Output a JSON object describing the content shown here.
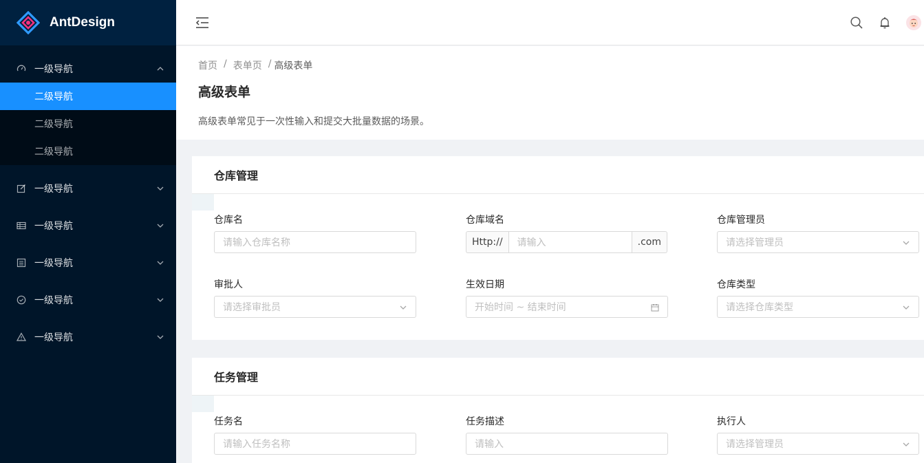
{
  "brand": {
    "name": "AntDesign"
  },
  "sidebar": {
    "items": [
      {
        "label": "一级导航",
        "icon": "dashboard-icon",
        "expanded": true,
        "children": [
          {
            "label": "二级导航",
            "active": true
          },
          {
            "label": "二级导航"
          },
          {
            "label": "二级导航"
          }
        ]
      },
      {
        "label": "一级导航",
        "icon": "form-icon"
      },
      {
        "label": "一级导航",
        "icon": "table-icon"
      },
      {
        "label": "一级导航",
        "icon": "profile-icon"
      },
      {
        "label": "一级导航",
        "icon": "check-circle-icon"
      },
      {
        "label": "一级导航",
        "icon": "warning-icon"
      }
    ]
  },
  "header": {
    "icons": [
      "menu-fold-icon",
      "search-icon",
      "bell-icon",
      "avatar"
    ]
  },
  "page": {
    "breadcrumb": [
      "首页",
      "/",
      "表单页",
      "/",
      "高级表单"
    ],
    "title": "高级表单",
    "description": "高级表单常见于一次性输入和提交大批量数据的场景。"
  },
  "warehouse": {
    "title": "仓库管理",
    "name_label": "仓库名",
    "name_placeholder": "请输入仓库名称",
    "domain_label": "仓库域名",
    "domain_prefix": "Http://",
    "domain_placeholder": "请输入",
    "domain_suffix": ".com",
    "admin_label": "仓库管理员",
    "admin_placeholder": "请选择管理员",
    "approver_label": "审批人",
    "approver_placeholder": "请选择审批员",
    "date_label": "生效日期",
    "date_placeholder": "开始时间 ~ 结束时间",
    "type_label": "仓库类型",
    "type_placeholder": "请选择仓库类型"
  },
  "task": {
    "title": "任务管理",
    "name_label": "任务名",
    "name_placeholder": "请输入任务名称",
    "desc_label": "任务描述",
    "desc_placeholder": "请输入",
    "exec_label": "执行人",
    "exec_placeholder": "请选择管理员"
  },
  "colors": {
    "primary": "#1890ff",
    "sider": "#001529",
    "logo_bg": "#002140"
  }
}
